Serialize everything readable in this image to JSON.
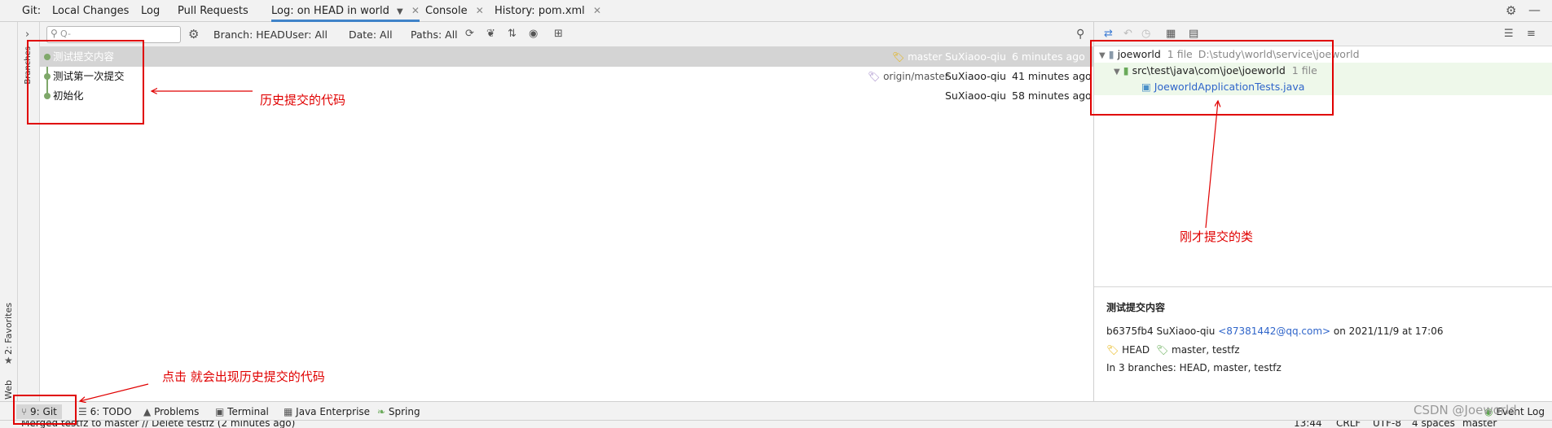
{
  "tabs": {
    "git_label": "Git:",
    "items": [
      {
        "label": "Local Changes"
      },
      {
        "label": "Log"
      },
      {
        "label": "Pull Requests"
      },
      {
        "label": "Log: on HEAD in world"
      },
      {
        "label": "Console"
      },
      {
        "label": "History: pom.xml"
      }
    ]
  },
  "filters": {
    "search_placeholder": "Q-",
    "branch": "Branch: HEAD",
    "user": "User: All",
    "date": "Date: All",
    "paths": "Paths: All"
  },
  "left_strip": {
    "branches": "Branches",
    "favorites": "2: Favorites",
    "web": "Web"
  },
  "commits": [
    {
      "message": "测试提交内容",
      "ref": "master",
      "author": "SuXiaoo-qiu",
      "date": "6 minutes ago",
      "selected": true
    },
    {
      "message": "测试第一次提交",
      "ref": "origin/master",
      "author": "SuXiaoo-qiu",
      "date": "41 minutes ago",
      "selected": false
    },
    {
      "message": "初始化",
      "ref": "",
      "author": "SuXiaoo-qiu",
      "date": "58 minutes ago",
      "selected": false
    }
  ],
  "changes_tree": {
    "root_name": "joeworld",
    "root_count": "1 file",
    "root_path": "D:\\study\\world\\service\\joeworld",
    "dir_name": "src\\test\\java\\com\\joe\\joeworld",
    "dir_count": "1 file",
    "file_name": "JoeworldApplicationTests.java"
  },
  "details": {
    "title": "测试提交内容",
    "hash_author": "b6375fb4 SuXiaoo-qiu",
    "email": "<87381442@qq.com>",
    "date_text": "on 2021/11/9 at 17:06",
    "head_label": "HEAD",
    "branches_label": "master, testfz",
    "in_branches": "In 3 branches: HEAD, master, testfz"
  },
  "bottom_tabs": [
    {
      "label": "9: Git"
    },
    {
      "label": "6: TODO"
    },
    {
      "label": "Problems"
    },
    {
      "label": "Terminal"
    },
    {
      "label": "Java Enterprise"
    },
    {
      "label": "Spring"
    }
  ],
  "bottom_right": {
    "event_log": "Event Log",
    "watermark": "CSDN @Joeworld"
  },
  "status": {
    "message": "Merged testfz to master // Delete testfz (2 minutes ago)",
    "position": "13:44",
    "line_sep": "CRLF",
    "encoding": "UTF-8",
    "indent": "4 spaces",
    "branch": "master"
  },
  "annotations": {
    "history": "历史提交的代码",
    "recent": "刚才提交的类",
    "click_hint": "点击 就会出现历史提交的代码"
  },
  "colors": {
    "annotation_red": "#e00000",
    "graph_green": "#7fa86a",
    "selection": "#d4d4d4",
    "link_blue": "#2f65ca"
  }
}
